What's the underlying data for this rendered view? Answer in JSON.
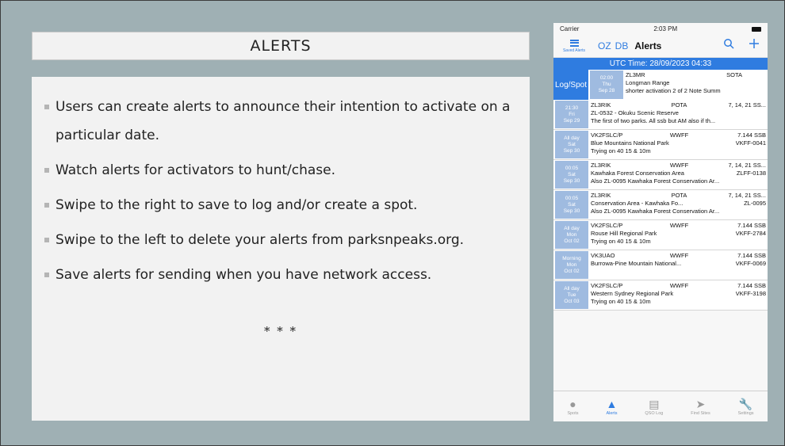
{
  "slide": {
    "title": "ALERTS",
    "bullets": [
      "Users can create alerts to announce their intention to activate on a particular date.",
      "Watch alerts for activators to hunt/chase.",
      "Swipe to the right to save to log and/or create a spot.",
      "Swipe to the left to delete your alerts from parksnpeaks.org.",
      "Save alerts for sending when you have network access."
    ],
    "footer": "* * *"
  },
  "phone": {
    "status": {
      "carrier": "Carrier",
      "time": "2:03 PM"
    },
    "nav": {
      "saved_label": "Saved Alerts",
      "oz": "OZ",
      "db": "DB",
      "title": "Alerts",
      "search_icon": "search-icon",
      "add_icon": "plus-icon"
    },
    "utc": "UTC Time: 28/09/2023 04:33",
    "logspot": {
      "label": "Log/Spot",
      "when": [
        "02:00",
        "Thu",
        "Sep 28"
      ],
      "callsign": "ZL3MR",
      "program": "SOTA",
      "name": "Longman Range",
      "comment": "shorter activation 2 of 2  Note Summ"
    },
    "alerts": [
      {
        "when": [
          "21:30",
          "Fri",
          "Sep 29"
        ],
        "callsign": "ZL3RIK",
        "program": "POTA",
        "freq": "7, 14, 21 SS...",
        "name": "ZL-0532 - Okuku Scenic Reserve",
        "ref": "",
        "comment": "The first of two parks. All ssb but AM also if th..."
      },
      {
        "when": [
          "All day",
          "Sat",
          "Sep 30"
        ],
        "callsign": "VK2FSLC/P",
        "program": "WWFF",
        "freq": "7.144 SSB",
        "name": "Blue Mountains National Park",
        "ref": "VKFF-0041",
        "comment": "Trying on 40 15 & 10m"
      },
      {
        "when": [
          "00:05",
          "Sat",
          "Sep 30"
        ],
        "callsign": "ZL3RIK",
        "program": "WWFF",
        "freq": "7, 14, 21 SS...",
        "name": "Kawhaka Forest Conservation Area",
        "ref": "ZLFF-0138",
        "comment": "Also ZL-0095 Kawhaka Forest Conservation Ar..."
      },
      {
        "when": [
          "00:05",
          "Sat",
          "Sep 30"
        ],
        "callsign": "ZL3RIK",
        "program": "POTA",
        "freq": "7, 14, 21 SS...",
        "name": "Conservation Area - Kawhaka Fo...",
        "ref": "ZL-0095",
        "comment": "Also ZL-0095 Kawhaka Forest Conservation Ar..."
      },
      {
        "when": [
          "All day",
          "Mon",
          "Oct 02"
        ],
        "callsign": "VK2FSLC/P",
        "program": "WWFF",
        "freq": "7.144 SSB",
        "name": "Rouse Hill Regional Park",
        "ref": "VKFF-2784",
        "comment": "Trying on 40 15 & 10m"
      },
      {
        "when": [
          "Morning",
          "Mon",
          "Oct 02"
        ],
        "callsign": "VK3UAO",
        "program": "WWFF",
        "freq": "7.144 SSB",
        "name": "Burrowa-Pine Mountain National...",
        "ref": "VKFF-0069",
        "comment": ""
      },
      {
        "when": [
          "All day",
          "Tue",
          "Oct 03"
        ],
        "callsign": "VK2FSLC/P",
        "program": "WWFF",
        "freq": "7.144 SSB",
        "name": "Western Sydney Regional Park",
        "ref": "VKFF-3198",
        "comment": "Trying on 40 15 & 10m"
      }
    ],
    "tabs": [
      {
        "label": "Spots",
        "icon": "spots-icon"
      },
      {
        "label": "Alerts",
        "icon": "alert-icon"
      },
      {
        "label": "QSO Log",
        "icon": "log-icon"
      },
      {
        "label": "Find Sites",
        "icon": "location-icon"
      },
      {
        "label": "Settings",
        "icon": "wrench-icon"
      }
    ],
    "accent": "#2f7ce0"
  }
}
